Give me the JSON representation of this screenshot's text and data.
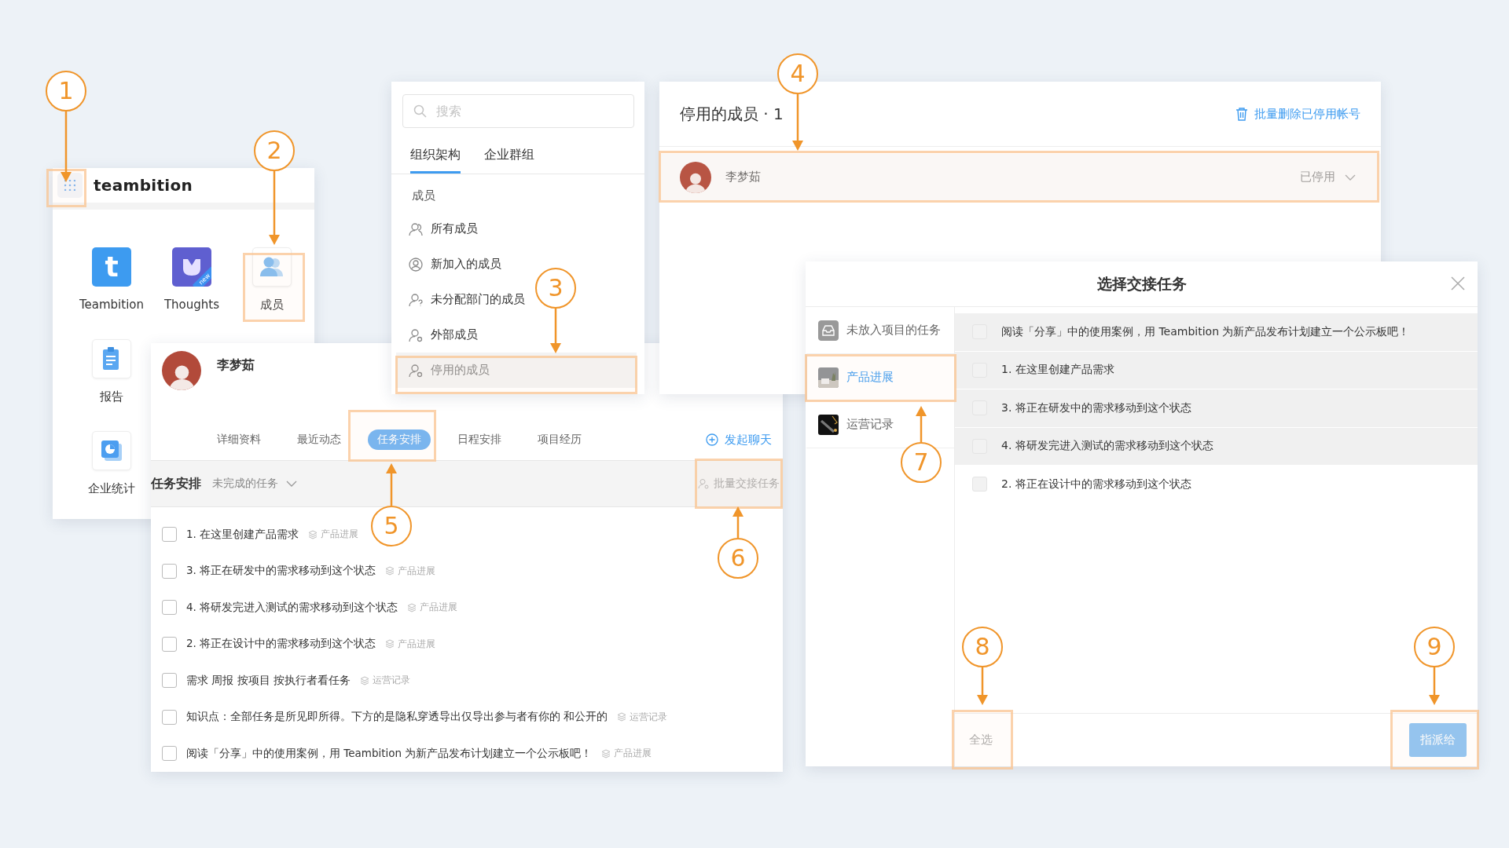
{
  "launcher": {
    "brand": "teambition",
    "apps": [
      {
        "label": "Teambition",
        "kind": "teambition",
        "logo_text": "t"
      },
      {
        "label": "Thoughts",
        "kind": "thoughts",
        "badge": "new"
      },
      {
        "label": "成员",
        "kind": "members"
      },
      {
        "label": "报告",
        "kind": "report"
      },
      {
        "label": "企业统计",
        "kind": "stats"
      }
    ]
  },
  "member_nav": {
    "search": {
      "placeholder": "搜索"
    },
    "tabs": [
      {
        "label": "组织架构",
        "selected": true
      },
      {
        "label": "企业群组",
        "selected": false
      }
    ],
    "section": "成员",
    "items": [
      {
        "label": "所有成员",
        "kind": "group",
        "selected": false
      },
      {
        "label": "新加入的成员",
        "kind": "new",
        "selected": false
      },
      {
        "label": "未分配部门的成员",
        "kind": "unassigned",
        "selected": false
      },
      {
        "label": "外部成员",
        "kind": "external",
        "selected": false
      },
      {
        "label": "停用的成员",
        "kind": "disabled",
        "selected": true
      }
    ]
  },
  "disabled_members": {
    "title": "停用的成员 · 1",
    "action": "批量删除已停用帐号",
    "rows": [
      {
        "name": "李梦茹",
        "status": "已停用"
      }
    ]
  },
  "profile": {
    "name": "李梦茹",
    "tabs": [
      {
        "label": "详细资料",
        "selected": false
      },
      {
        "label": "最近动态",
        "selected": false
      },
      {
        "label": "任务安排",
        "selected": true
      },
      {
        "label": "日程安排",
        "selected": false
      },
      {
        "label": "项目经历",
        "selected": false
      }
    ],
    "chat": "发起聊天",
    "filter_title": "任务安排",
    "filter": "未完成的任务",
    "batch": "批量交接任务",
    "tasks": [
      {
        "title": "1. 在这里创建产品需求",
        "project": "产品进展",
        "checked": false
      },
      {
        "title": "3. 将正在研发中的需求移动到这个状态",
        "project": "产品进展",
        "checked": false
      },
      {
        "title": "4. 将研发完进入测试的需求移动到这个状态",
        "project": "产品进展",
        "checked": false
      },
      {
        "title": "2. 将正在设计中的需求移动到这个状态",
        "project": "产品进展",
        "checked": false
      },
      {
        "title": "需求 周报 按项目 按执行者看任务",
        "project": "运营记录",
        "checked": false
      },
      {
        "title": "知识点：全部任务是所见即所得。下方的是隐私穿透导出仅导出参与者有你的 和公开的",
        "project": "运营记录",
        "checked": false
      },
      {
        "title": "阅读「分享」中的使用案例，用 Teambition 为新产品发布计划建立一个公示板吧！",
        "project": "产品进展",
        "checked": false
      }
    ]
  },
  "handover_dialog": {
    "title": "选择交接任务",
    "projects": [
      {
        "label": "未放入项目的任务",
        "kind": "inbox",
        "selected": false
      },
      {
        "label": "产品进展",
        "kind": "picture",
        "selected": true
      },
      {
        "label": "运营记录",
        "kind": "picture",
        "selected": false
      }
    ],
    "tasks": [
      {
        "title": "阅读「分享」中的使用案例，用 Teambition 为新产品发布计划建立一个公示板吧！",
        "checked": false,
        "shaded": true
      },
      {
        "title": "1. 在这里创建产品需求",
        "checked": false,
        "shaded": true
      },
      {
        "title": "3. 将正在研发中的需求移动到这个状态",
        "checked": false,
        "shaded": true
      },
      {
        "title": "4. 将研发完进入测试的需求移动到这个状态",
        "checked": false,
        "shaded": true
      },
      {
        "title": "2. 将正在设计中的需求移动到这个状态",
        "checked": false,
        "shaded": false
      }
    ],
    "select_all": "全选",
    "assign": "指派给"
  },
  "callouts": [
    {
      "number": "1"
    },
    {
      "number": "2"
    },
    {
      "number": "3"
    },
    {
      "number": "4"
    },
    {
      "number": "5"
    },
    {
      "number": "6"
    },
    {
      "number": "7"
    },
    {
      "number": "8"
    },
    {
      "number": "9"
    }
  ]
}
